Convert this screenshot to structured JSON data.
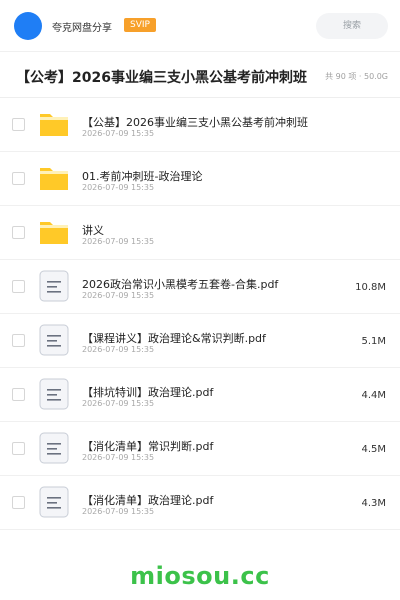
{
  "header": {
    "share_name": "夸克网盘分享",
    "badge": "SVIP",
    "search_placeholder": "搜索"
  },
  "folder": {
    "title": "【公考】2026事业编三支小黑公基考前冲刺班",
    "meta": "共 90 项 · 50.0G"
  },
  "files": [
    {
      "type": "folder",
      "name": "【公基】2026事业编三支小黑公基考前冲刺班",
      "date": "2026-07-09 15:35",
      "size": ""
    },
    {
      "type": "folder",
      "name": "01.考前冲刺班-政治理论",
      "date": "2026-07-09 15:35",
      "size": ""
    },
    {
      "type": "folder",
      "name": "讲义",
      "date": "2026-07-09 15:35",
      "size": ""
    },
    {
      "type": "doc",
      "name": "2026政治常识小黑模考五套卷-合集.pdf",
      "date": "2026-07-09 15:35",
      "size": "10.8M"
    },
    {
      "type": "doc",
      "name": "【课程讲义】政治理论&常识判断.pdf",
      "date": "2026-07-09 15:35",
      "size": "5.1M"
    },
    {
      "type": "doc",
      "name": "【排坑特训】政治理论.pdf",
      "date": "2026-07-09 15:35",
      "size": "4.4M"
    },
    {
      "type": "doc",
      "name": "【消化清单】常识判断.pdf",
      "date": "2026-07-09 15:35",
      "size": "4.5M"
    },
    {
      "type": "doc",
      "name": "【消化清单】政治理论.pdf",
      "date": "2026-07-09 15:35",
      "size": "4.3M"
    }
  ],
  "watermark": "miosou.cc",
  "colors": {
    "avatar": "#1f7ef5",
    "badge": "#f7a02a",
    "folder_icon": "#ffc928",
    "watermark": "#3cc24a"
  }
}
